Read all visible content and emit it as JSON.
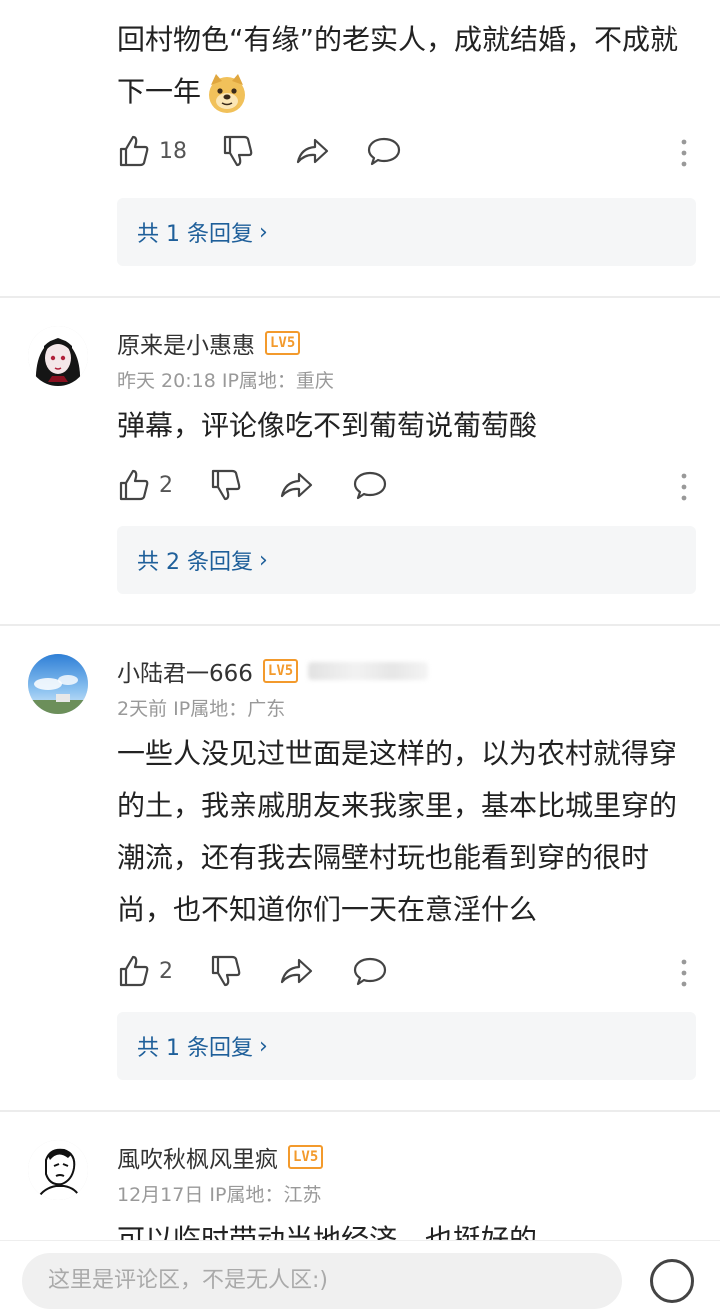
{
  "comments": [
    {
      "text": "回村物色“有缘”的老实人，成就结婚，不成就下一年",
      "likes": "18",
      "reply_label": "共 1 条回复",
      "emoji": "doge-emoji"
    },
    {
      "username": "原来是小惠惠",
      "level": "LV5",
      "meta": "昨天 20:18 IP属地：重庆",
      "text": "弹幕，评论像吃不到葡萄说葡萄酸",
      "likes": "2",
      "reply_label": "共 2 条回复"
    },
    {
      "username": "小陆君一666",
      "level": "LV5",
      "meta": "2天前 IP属地：广东",
      "text": "一些人没见过世面是这样的，以为农村就得穿的土，我亲戚朋友来我家里，基本比城里穿的潮流，还有我去隔壁村玩也能看到穿的很时尚，也不知道你们一天在意淫什么",
      "likes": "2",
      "reply_label": "共 1 条回复"
    },
    {
      "username": "風吹秋枫风里疯",
      "level": "LV5",
      "meta": "12月17日 IP属地：江苏",
      "text": "可以临时带动当地经济，也挺好的。"
    }
  ],
  "bottom_bar": {
    "placeholder": "这里是评论区，不是无人区:)"
  },
  "icons": {
    "like": "thumbs-up-icon",
    "dislike": "thumbs-down-icon",
    "share": "share-arrow-icon",
    "comment": "speech-bubble-icon",
    "more": "more-vertical-icon"
  },
  "colors": {
    "level_badge": "#f39a2c",
    "reply_link": "#1e5f9a",
    "meta_text": "#999999"
  }
}
